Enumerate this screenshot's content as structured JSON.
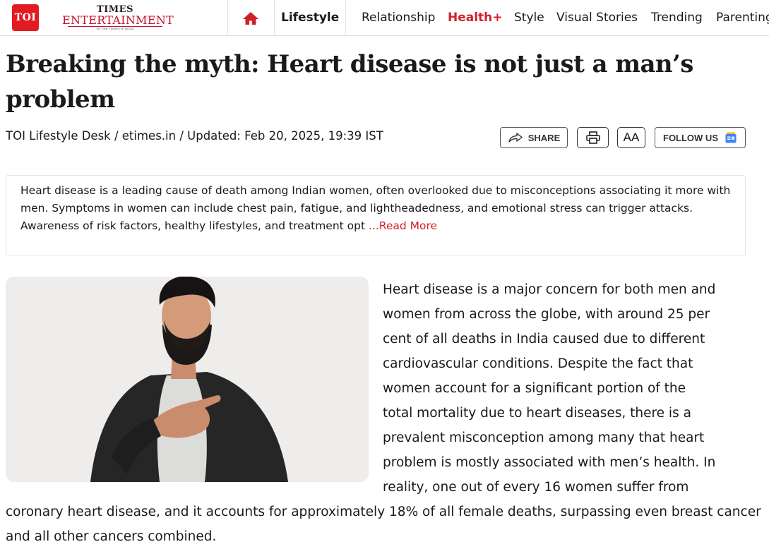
{
  "nav": {
    "logo": "TOI",
    "brand_top": "TIMES",
    "brand_main": "ENTERTAINMENT",
    "brand_sub": "BY THE TIMES OF INDIA",
    "home_icon": "home-icon",
    "active": "Lifestyle",
    "items": [
      "Relationship",
      "Health+",
      "Style",
      "Visual Stories",
      "Trending",
      "Parenting"
    ],
    "accent": "#d0212b"
  },
  "article": {
    "title": "Breaking the myth: Heart disease is not just a man’s problem",
    "byline": "TOI Lifestyle Desk / etimes.in / Updated: Feb 20, 2025, 19:39 IST",
    "actions": {
      "share": "SHARE",
      "print_icon": "printer-icon",
      "font_size": "AA",
      "follow": "FOLLOW US",
      "google_news_icon": "google-news-icon"
    },
    "summary": {
      "text": "Heart disease is a leading cause of death among Indian women, often overlooked due to misconceptions associating it more with men. Symptoms in women can include chest pain, fatigue, and lightheadedness, and emotional stress can trigger attacks. Awareness of risk factors, healthy lifestyles, and treatment opt",
      "more": "...Read More"
    },
    "body_lines": [
      "Heart disease is a major concern for both men and",
      "women from across the globe, with around 25 per",
      "cent of all deaths in India caused due to different",
      "cardiovascular conditions. Despite the fact that",
      "women account for a significant portion of the",
      "total mortality due to heart diseases, there is a",
      "prevalent misconception among many that heart",
      "problem is mostly associated with men’s health. In",
      "reality, one out of every 16 women suffer from"
    ],
    "body_continued": "coronary heart disease, and it accounts for approximately 18% of all female deaths, surpassing even breast cancer and all other cancers combined."
  }
}
